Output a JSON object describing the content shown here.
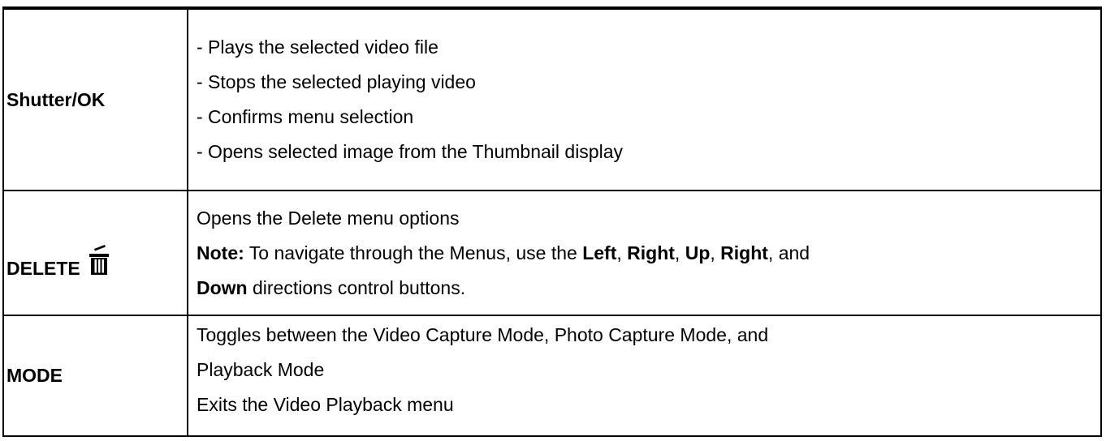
{
  "rows": [
    {
      "key": "Shutter/OK",
      "lines": [
        "- Plays the selected video file",
        "- Stops the selected playing video",
        "- Confirms menu selection",
        "- Opens selected image from the Thumbnail display"
      ]
    },
    {
      "key": "DELETE",
      "icon": "trash-can-icon",
      "line1": "Opens the Delete menu options",
      "note": {
        "label": "Note:",
        "t1": " To navigate through the Menus, use the ",
        "b1": "Left",
        "t2": ", ",
        "b2": "Right",
        "t3": ", ",
        "b3": "Up",
        "t4": ", ",
        "b4": "Right",
        "t5": ", and",
        "b5": "Down",
        "t6": " directions control buttons."
      }
    },
    {
      "key": "MODE",
      "lines": [
        "Toggles between the Video Capture Mode, Photo Capture Mode, and",
        "Playback Mode",
        "Exits the Video Playback menu"
      ]
    }
  ]
}
